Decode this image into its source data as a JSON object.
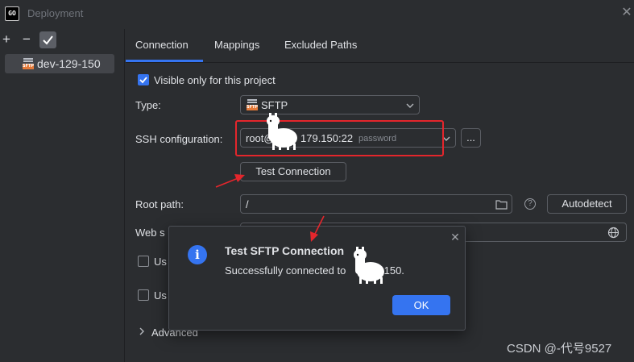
{
  "window": {
    "title": "Deployment",
    "logo_text": "GO"
  },
  "toolbar": {
    "add": "+",
    "remove": "−"
  },
  "servers": [
    {
      "name": "dev-129-150",
      "icon_label": "SFTP"
    }
  ],
  "tabs": [
    {
      "label": "Connection",
      "active": true
    },
    {
      "label": "Mappings",
      "active": false
    },
    {
      "label": "Excluded Paths",
      "active": false
    }
  ],
  "connection": {
    "visible_only_label": "Visible only for this project",
    "visible_only_checked": true,
    "type_label": "Type:",
    "type_value": "SFTP",
    "type_icon_label": "SFTP",
    "ssh_label": "SSH configuration:",
    "ssh_value": "root@",
    "ssh_value_suffix": "179.150:22",
    "ssh_auth": "password",
    "ssh_more": "...",
    "test_button": "Test Connection",
    "root_label": "Root path:",
    "root_value": "/",
    "help": "?",
    "autodetect_button": "Autodetect",
    "web_label": "Web s",
    "check1_label": "Us",
    "check2_label": "Us",
    "advanced_label": "Advanced"
  },
  "dialog": {
    "title": "Test SFTP Connection",
    "message_prefix": "Successfully connected to",
    "message_suffix": "179.150.",
    "ok_button": "OK",
    "close": "✕"
  },
  "watermark": "CSDN @-代号9527",
  "colors": {
    "accent": "#3574f0",
    "annotation": "#e4262c",
    "sftp_orange": "#e47a3a",
    "background": "#2b2d30"
  }
}
